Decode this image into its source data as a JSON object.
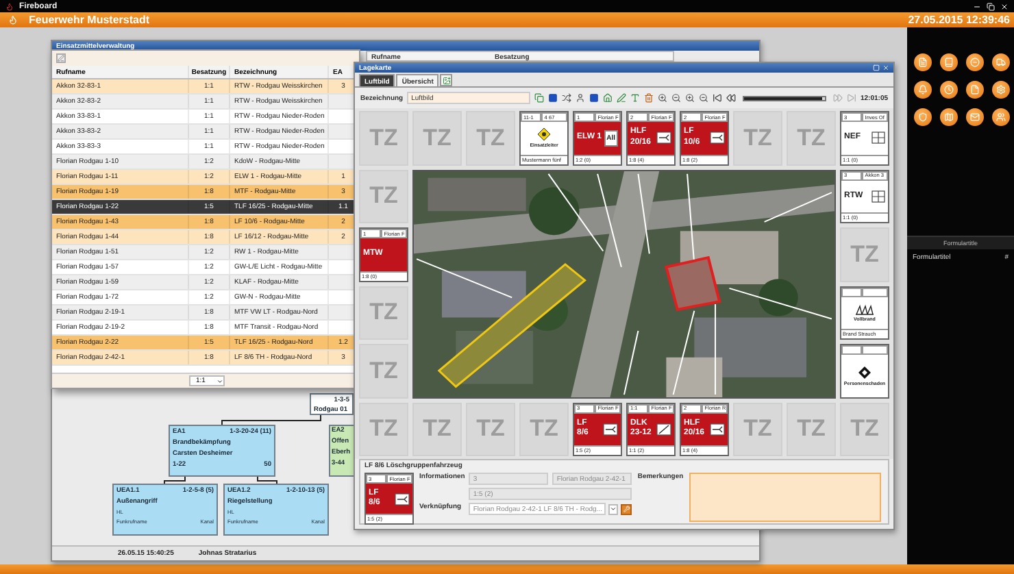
{
  "app": {
    "title": "Fireboard",
    "organization": "Feuerwehr Musterstadt",
    "datetime": "27.05.2015 12:39:46"
  },
  "resource_window": {
    "title": "Einsatzmittelverwaltung",
    "back_columns": [
      "Rufname",
      "Besatzung"
    ],
    "table": {
      "columns": [
        "Rufname",
        "Besatzung",
        "Bezeichnung",
        "EA"
      ],
      "rows": [
        {
          "cells": [
            "Akkon 32-83-1",
            "1:1",
            "RTW - Rodgau Weisskirchen",
            "3"
          ],
          "color": "#fde4bd",
          "selected": false
        },
        {
          "cells": [
            "Akkon 32-83-2",
            "1:1",
            "RTW - Rodgau Weisskirchen",
            ""
          ],
          "selected": false
        },
        {
          "cells": [
            "Akkon 33-83-1",
            "1:1",
            "RTW - Rodgau Nieder-Roden",
            ""
          ],
          "selected": false
        },
        {
          "cells": [
            "Akkon 33-83-2",
            "1:1",
            "RTW - Rodgau Nieder-Roden",
            ""
          ],
          "selected": false
        },
        {
          "cells": [
            "Akkon 33-83-3",
            "1:1",
            "RTW - Rodgau Nieder-Roden",
            ""
          ],
          "selected": false
        },
        {
          "cells": [
            "Florian Rodgau 1-10",
            "1:2",
            "KdoW - Rodgau-Mitte",
            ""
          ],
          "selected": false
        },
        {
          "cells": [
            "Florian Rodgau 1-11",
            "1:2",
            "ELW 1 - Rodgau-Mitte",
            "1"
          ],
          "color": "#fde4bd",
          "selected": false
        },
        {
          "cells": [
            "Florian Rodgau 1-19",
            "1:8",
            "MTF - Rodgau-Mitte",
            "3"
          ],
          "color": "#f7c16d",
          "selected": false
        },
        {
          "cells": [
            "Florian Rodgau 1-22",
            "1:5",
            "TLF 16/25 - Rodgau-Mitte",
            "1.1"
          ],
          "selected": true
        },
        {
          "cells": [
            "Florian Rodgau 1-43",
            "1:8",
            "LF 10/6 - Rodgau-Mitte",
            "2"
          ],
          "color": "#f7c16d",
          "selected": false
        },
        {
          "cells": [
            "Florian Rodgau 1-44",
            "1:8",
            "LF 16/12 - Rodgau-Mitte",
            "2"
          ],
          "color": "#fde4bd",
          "selected": false
        },
        {
          "cells": [
            "Florian Rodgau 1-51",
            "1:2",
            "RW 1 - Rodgau-Mitte",
            ""
          ],
          "selected": false
        },
        {
          "cells": [
            "Florian Rodgau 1-57",
            "1:2",
            "GW-L/E Licht - Rodgau-Mitte",
            ""
          ],
          "selected": false
        },
        {
          "cells": [
            "Florian Rodgau 1-59",
            "1:2",
            "KLAF - Rodgau-Mitte",
            ""
          ],
          "selected": false
        },
        {
          "cells": [
            "Florian Rodgau 1-72",
            "1:2",
            "GW-N - Rodgau-Mitte",
            ""
          ],
          "selected": false
        },
        {
          "cells": [
            "Florian Rodgau 2-19-1",
            "1:8",
            "MTF VW LT - Rodgau-Nord",
            ""
          ],
          "selected": false
        },
        {
          "cells": [
            "Florian Rodgau 2-19-2",
            "1:8",
            "MTF Transit - Rodgau-Nord",
            ""
          ],
          "selected": false
        },
        {
          "cells": [
            "Florian Rodgau 2-22",
            "1:5",
            "TLF 16/25 - Rodgau-Nord",
            "1.2"
          ],
          "color": "#f7c16d",
          "selected": false
        },
        {
          "cells": [
            "Florian Rodgau 2-42-1",
            "1:8",
            "LF 8/6 TH - Rodgau-Nord",
            "3"
          ],
          "color": "#fde4bd",
          "selected": false
        }
      ],
      "footer_ratio": "1:1"
    },
    "org_chart": {
      "root": {
        "code": "1-3-5",
        "name": "Rodgau 01"
      },
      "sections": [
        {
          "id": "EA1",
          "code": "1-3-20-24 (11)",
          "task": "Brandbekämpfung",
          "leader": "Carsten Desheimer",
          "unit": "1-22",
          "channel": "50",
          "color": "#aadcf4"
        },
        {
          "id": "EA2",
          "task": "Offen",
          "leader": "Eberh",
          "unit": "3-44",
          "color": "#c8e8b4"
        }
      ],
      "subsections": [
        {
          "id": "UEA1.1",
          "code": "1-2-5-8 (5)",
          "task": "Außenangriff",
          "role": "HL",
          "radio": "Funkrufname",
          "channel": "Kanal"
        },
        {
          "id": "UEA1.2",
          "code": "1-2-10-13 (5)",
          "task": "Riegelstellung",
          "role": "HL",
          "radio": "Funkrufname",
          "channel": "Kanal"
        }
      ]
    },
    "status_bar": {
      "started": "26.05.15 15:40:25",
      "leader": "Johnas Stratarius"
    }
  },
  "map_window": {
    "title": "Lagekarte",
    "tabs": [
      {
        "label": "Luftbild",
        "selected": true
      },
      {
        "label": "Übersicht",
        "selected": false
      }
    ],
    "name_label": "Bezeichnung",
    "name_value": "Luftbild",
    "playback": {
      "level": 0.96,
      "time": "12:01:05"
    },
    "tiles": {
      "top": [
        {
          "kind": "empty",
          "label": "TZ"
        },
        {
          "kind": "empty",
          "label": "TZ"
        },
        {
          "kind": "empty",
          "label": "TZ"
        },
        {
          "kind": "leader",
          "number": "11-1",
          "unit": "4 67",
          "caption": "Einsatzleiter",
          "strength": "Mustermann fünf"
        },
        {
          "kind": "vehicle",
          "number": "1",
          "unit": "Florian F",
          "lines": [
            "ELW 1"
          ],
          "badge": "All",
          "strength": "1:2 (0)"
        },
        {
          "kind": "vehicle",
          "number": "2",
          "unit": "Florian F",
          "lines": [
            "HLF",
            "20/16"
          ],
          "symbol": {
            "kind": "pump"
          },
          "strength": "1:8 (4)"
        },
        {
          "kind": "vehicle",
          "number": "2",
          "unit": "Florian F",
          "lines": [
            "LF",
            "10/6"
          ],
          "symbol": {
            "kind": "pump"
          },
          "strength": "1:8 (2)"
        },
        {
          "kind": "empty",
          "label": "TZ"
        },
        {
          "kind": "empty",
          "label": "TZ"
        },
        {
          "kind": "unit",
          "number": "3",
          "unit": "Inves Of",
          "lines": [
            "NEF"
          ],
          "symbol": {
            "kind": "grid"
          },
          "strength": "1:1 (0)"
        }
      ],
      "left": [
        {
          "kind": "empty",
          "label": "TZ"
        },
        {
          "kind": "vehicle",
          "number": "1",
          "unit": "Florian F",
          "lines": [
            "MTW"
          ],
          "strength": "1:8 (0)"
        },
        {
          "kind": "empty",
          "label": "TZ"
        },
        {
          "kind": "empty",
          "label": "TZ"
        }
      ],
      "right": [
        {
          "kind": "unit",
          "number": "3",
          "unit": "Akkon 3",
          "lines": [
            "RTW"
          ],
          "symbol": {
            "kind": "grid"
          },
          "strength": "1:1 (0)"
        },
        {
          "kind": "empty",
          "label": "TZ"
        },
        {
          "kind": "hazard",
          "symbol": {
            "kind": "fire"
          },
          "caption": "Vollbrand",
          "strength": "Brand Strauch"
        },
        {
          "kind": "hazard",
          "symbol": {
            "kind": "diamond"
          },
          "caption": "Personenschaden"
        }
      ],
      "bottom": [
        {
          "kind": "empty",
          "label": "TZ"
        },
        {
          "kind": "empty",
          "label": "TZ"
        },
        {
          "kind": "empty",
          "label": "TZ"
        },
        {
          "kind": "empty",
          "label": "TZ"
        },
        {
          "kind": "vehicle",
          "number": "3",
          "unit": "Florian F",
          "lines": [
            "LF",
            "8/6"
          ],
          "symbol": {
            "kind": "pump"
          },
          "strength": "1:5 (2)"
        },
        {
          "kind": "vehicle",
          "number": "1:1",
          "unit": "Florian F",
          "lines": [
            "DLK",
            "23-12"
          ],
          "symbol": {
            "kind": "ladder"
          },
          "strength": "1:1 (2)"
        },
        {
          "kind": "vehicle",
          "number": "2",
          "unit": "Florian R",
          "lines": [
            "HLF",
            "20/16"
          ],
          "symbol": {
            "kind": "pump"
          },
          "strength": "1:8 (4)"
        },
        {
          "kind": "empty",
          "label": "TZ"
        },
        {
          "kind": "empty",
          "label": "TZ"
        },
        {
          "kind": "empty",
          "label": "TZ"
        }
      ]
    },
    "details": {
      "title": "LF 8/6 Löschgruppenfahrzeug",
      "card": {
        "kind": "vehicle",
        "number": "3",
        "unit": "Florian F",
        "lines": [
          "LF",
          "8/6"
        ],
        "symbol": {
          "kind": "pump"
        },
        "strength": "1:5 (2)"
      },
      "info_label": "Informationen",
      "info_values": [
        "3",
        "Florian Rodgau 2-42-1",
        "1:5 (2)"
      ],
      "link_label": "Verknüpfung",
      "link_value": "Florian Rodgau 2-42-1 LF 8/6 TH - Rodg...",
      "remarks_label": "Bemerkungen"
    }
  },
  "side_panel": {
    "form_header": "Formulartitle",
    "form_columns": [
      "Formulartitel",
      "#"
    ]
  }
}
